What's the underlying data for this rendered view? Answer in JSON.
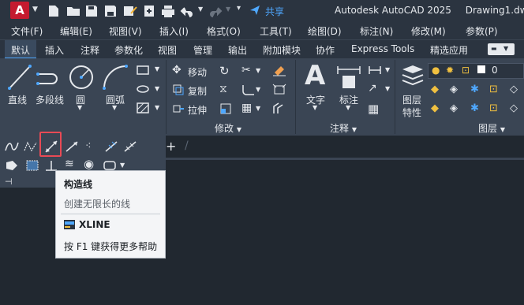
{
  "titlebar": {
    "logo_letter": "A",
    "share_label": "共享",
    "app_title": "Autodesk AutoCAD 2025",
    "drawing_name": "Drawing1.dwg"
  },
  "menubar": {
    "items": [
      "文件(F)",
      "编辑(E)",
      "视图(V)",
      "插入(I)",
      "格式(O)",
      "工具(T)",
      "绘图(D)",
      "标注(N)",
      "修改(M)",
      "参数(P)"
    ]
  },
  "ribbon_tabs": [
    "默认",
    "插入",
    "注释",
    "参数化",
    "视图",
    "管理",
    "输出",
    "附加模块",
    "协作",
    "Express Tools",
    "精选应用"
  ],
  "draw_panel": {
    "line_label": "直线",
    "polyline_label": "多段线",
    "circle_label": "圆",
    "arc_label": "圆弧"
  },
  "modify_panel": {
    "title": "修改",
    "move_label": "移动",
    "copy_label": "复制",
    "stretch_label": "拉伸"
  },
  "annotation_panel": {
    "title": "注释",
    "text_label": "文字",
    "dimension_label": "标注"
  },
  "layers_panel": {
    "title": "图层",
    "layer_props_label": "图层\n特性",
    "layer_props_line1": "图层",
    "layer_props_line2": "特性",
    "current_layer": "0"
  },
  "tooltip": {
    "title": "构造线",
    "description": "创建无限长的线",
    "command": "XLINE",
    "help": "按 F1 键获得更多帮助"
  },
  "colors": {
    "accent": "#4fa8ff",
    "highlight": "#e84a55",
    "logo": "#c41a2f"
  }
}
